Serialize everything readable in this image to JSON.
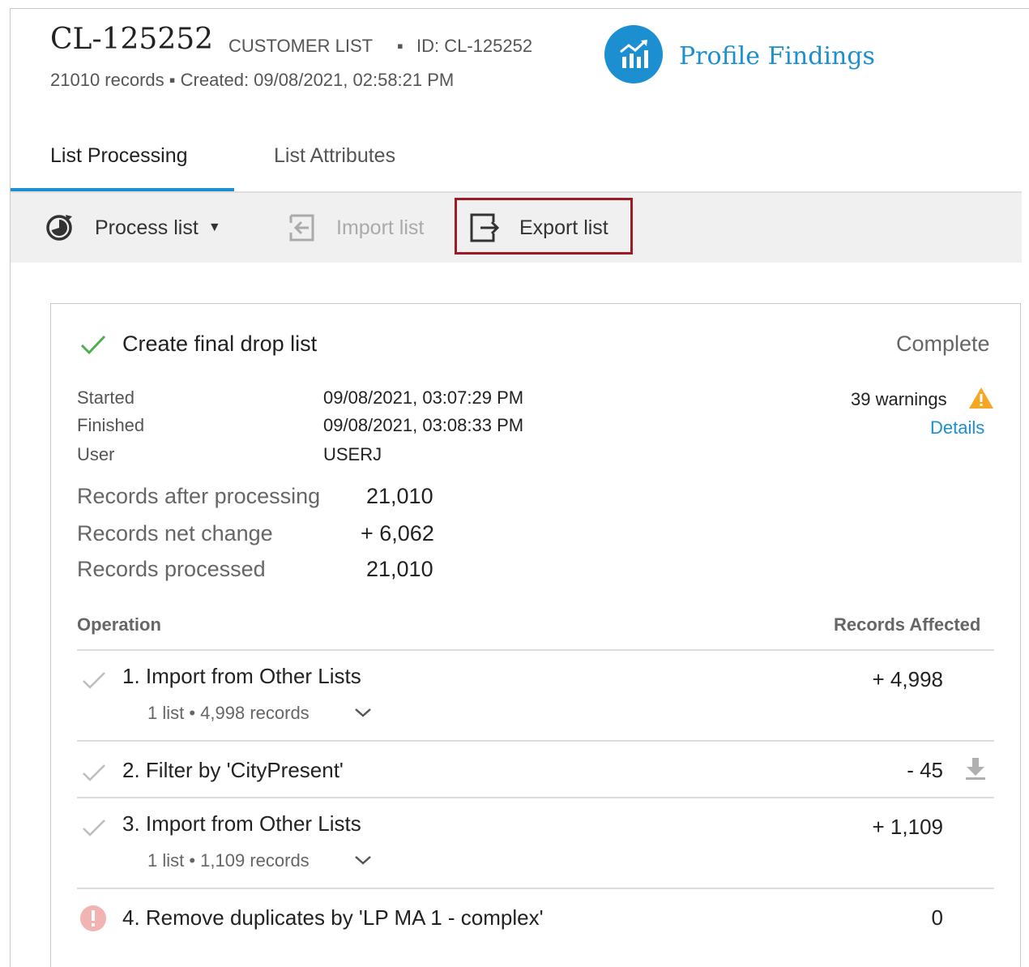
{
  "header": {
    "list_id": "CL-125252",
    "list_type": "CUSTOMER LIST",
    "separator": "▪",
    "id_label": "ID: CL-125252",
    "meta": "21010 records  ▪  Created: 09/08/2021, 02:58:21 PM",
    "profile_findings": "Profile Findings"
  },
  "tabs": [
    {
      "label": "List Processing",
      "active": true
    },
    {
      "label": "List Attributes",
      "active": false
    }
  ],
  "toolbar": {
    "process_label": "Process list",
    "import_label": "Import list",
    "export_label": "Export list"
  },
  "job": {
    "title": "Create final drop list",
    "status": "Complete",
    "started_label": "Started",
    "started_value": "09/08/2021, 03:07:29 PM",
    "finished_label": "Finished",
    "finished_value": "09/08/2021, 03:08:33 PM",
    "user_label": "User",
    "user_value": "USERJ",
    "warnings": "39 warnings",
    "details_link": "Details",
    "stats": [
      {
        "label": "Records after processing",
        "value": "21,010"
      },
      {
        "label": "Records net change",
        "value": "+ 6,062"
      },
      {
        "label": "Records processed",
        "value": "21,010"
      }
    ],
    "col_operation": "Operation",
    "col_affected": "Records Affected",
    "operations": [
      {
        "name": "1. Import from Other Lists",
        "sub": "1 list • 4,998 records",
        "value": "+ 4,998"
      },
      {
        "name": "2. Filter by 'CityPresent'",
        "sub": "",
        "value": "- 45"
      },
      {
        "name": "3. Import from Other Lists",
        "sub": "1 list • 1,109 records",
        "value": "+ 1,109"
      },
      {
        "name": "4. Remove duplicates by 'LP MA 1 - complex'",
        "sub": "",
        "value": "0"
      }
    ]
  },
  "colors": {
    "accent": "#1b8fd0",
    "highlight_border": "#9e1b26",
    "success": "#4caf50",
    "warning": "#f5a623",
    "error": "#f2b3b3"
  }
}
